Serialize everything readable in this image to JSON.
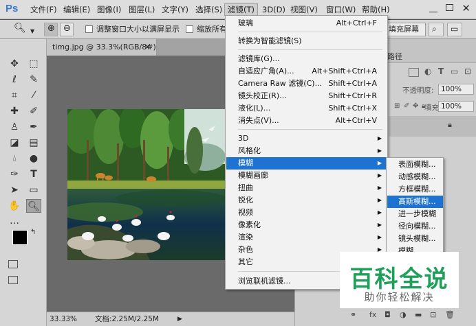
{
  "app": {
    "logo": "Ps"
  },
  "menubar": {
    "items": [
      "文件(F)",
      "编辑(E)",
      "图像(I)",
      "图层(L)",
      "文字(Y)",
      "选择(S)",
      "滤镜(T)",
      "3D(D)",
      "视图(V)",
      "窗口(W)",
      "帮助(H)"
    ],
    "active": "滤镜(T)"
  },
  "options": {
    "resize_windows_label": "调整窗口大小以满屏显示",
    "zoom_all_label": "缩放所有",
    "fill_screen_label": "填充屏幕"
  },
  "document": {
    "tab_title": "timg.jpg @ 33.3%(RGB/8#)",
    "zoom": "33.33%",
    "doc_info": "文档:2.25M/2.25M"
  },
  "filter_menu": {
    "items": [
      {
        "label": "玻璃",
        "shortcut": "Alt+Ctrl+F"
      },
      {
        "label": "转换为智能滤镜(S)",
        "shortcut": ""
      },
      {
        "label": "滤镜库(G)...",
        "shortcut": ""
      },
      {
        "label": "自适应广角(A)...",
        "shortcut": "Alt+Shift+Ctrl+A"
      },
      {
        "label": "Camera Raw 滤镜(C)...",
        "shortcut": "Shift+Ctrl+A"
      },
      {
        "label": "镜头校正(R)...",
        "shortcut": "Shift+Ctrl+R"
      },
      {
        "label": "液化(L)...",
        "shortcut": "Shift+Ctrl+X"
      },
      {
        "label": "消失点(V)...",
        "shortcut": "Alt+Ctrl+V"
      },
      {
        "label": "3D",
        "shortcut": ""
      },
      {
        "label": "风格化",
        "shortcut": ""
      },
      {
        "label": "模糊",
        "shortcut": ""
      },
      {
        "label": "模糊画廊",
        "shortcut": ""
      },
      {
        "label": "扭曲",
        "shortcut": ""
      },
      {
        "label": "锐化",
        "shortcut": ""
      },
      {
        "label": "视频",
        "shortcut": ""
      },
      {
        "label": "像素化",
        "shortcut": ""
      },
      {
        "label": "渲染",
        "shortcut": ""
      },
      {
        "label": "杂色",
        "shortcut": ""
      },
      {
        "label": "其它",
        "shortcut": ""
      },
      {
        "label": "浏览联机滤镜...",
        "shortcut": ""
      }
    ],
    "highlighted": "模糊"
  },
  "blur_submenu": {
    "items": [
      "表面模糊...",
      "动感模糊...",
      "方框模糊...",
      "高斯模糊...",
      "进一步模糊",
      "径向模糊...",
      "镜头模糊...",
      "模糊"
    ],
    "highlighted": "高斯模糊..."
  },
  "layers_panel": {
    "tab_label": "路径",
    "opacity_label": "不透明度:",
    "opacity_value": "100%",
    "fill_label": "填充:",
    "fill_value": "100%"
  },
  "watermark": {
    "title": "百科全说",
    "subtitle": "助你轻松解决"
  },
  "colors": {
    "menu_highlight": "#1e73d2",
    "watermark_green": "#1fa05a"
  }
}
